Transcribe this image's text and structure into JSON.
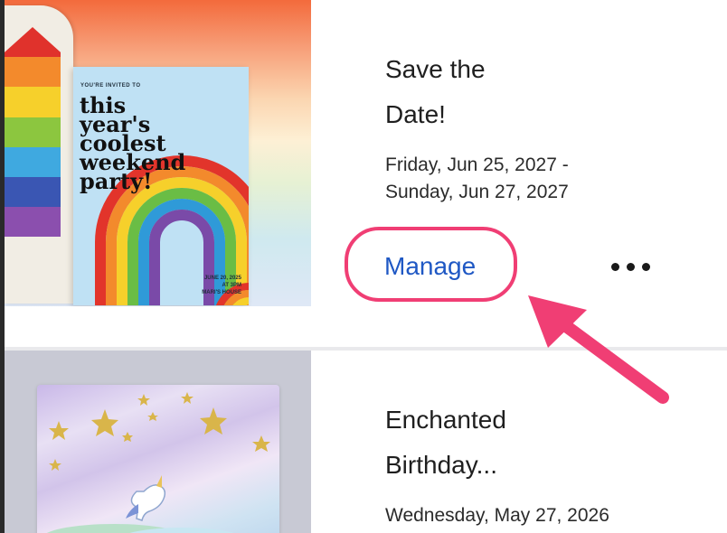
{
  "events": [
    {
      "title_line1": "Save the",
      "title_line2": "Date!",
      "date_line1": "Friday, Jun 25, 2027 -",
      "date_line2": "Sunday, Jun 27, 2027",
      "manage_label": "Manage",
      "more_icon": "more-horizontal-icon",
      "invite": {
        "kicker": "YOU'RE INVITED TO",
        "headline": "this year's coolest weekend party!",
        "footer": "JUNE 20, 2025\nAT 3PM\nMARI'S HOUSE"
      }
    },
    {
      "title_line1": "Enchanted",
      "title_line2": "Birthday...",
      "date_line1": "Wednesday, May 27, 2026"
    }
  ],
  "colors": {
    "link": "#1f58c4",
    "highlight": "#f03e74",
    "divider": "#e9e9ec"
  }
}
